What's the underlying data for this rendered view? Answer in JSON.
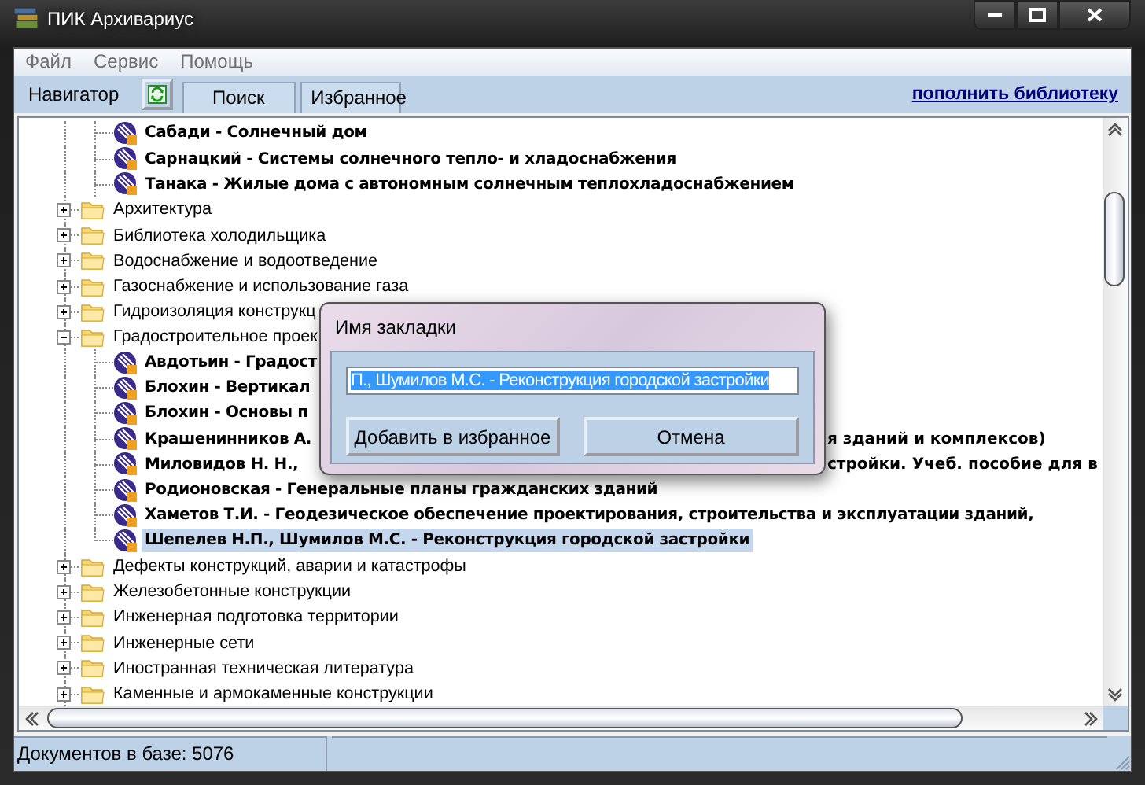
{
  "window": {
    "title": "ПИК Архивариус"
  },
  "menu": [
    "Файл",
    "Сервис",
    "Помощь"
  ],
  "tabs": [
    {
      "label": "Навигатор",
      "selected": true
    },
    {
      "label": "Поиск",
      "selected": false
    },
    {
      "label": "Избранное",
      "selected": false
    }
  ],
  "library_link": "пополнить библиотеку",
  "tree": {
    "items": [
      {
        "kind": "continuation",
        "children": [
          {
            "label": "Сабади - Солнечный дом",
            "selected": false
          },
          {
            "label": "Сарнацкий - Системы солнечного тепло- и хладоснабжения",
            "selected": false
          },
          {
            "label": "Танака - Жилые дома с автономным солнечным теплохладоснабжением",
            "selected": false
          }
        ]
      },
      {
        "kind": "folder",
        "label": "Архитектура",
        "expanded": false
      },
      {
        "kind": "folder",
        "label": "Библиотека холодильщика",
        "expanded": false
      },
      {
        "kind": "folder",
        "label": "Водоснабжение и водоотведение",
        "expanded": false
      },
      {
        "kind": "folder",
        "label": "Газоснабжение и использование газа",
        "expanded": false
      },
      {
        "kind": "folder",
        "label": "Гидроизоляция конструкц",
        "expanded": false
      },
      {
        "kind": "folder",
        "label": "Градостроительное проек",
        "expanded": true,
        "children": [
          {
            "label": "Авдотьин - Градост",
            "selected": false
          },
          {
            "label": "Блохин - Вертикал",
            "selected": false
          },
          {
            "label": "Блохин - Основы п",
            "selected": false
          },
          {
            "label": "Крашенинников А.",
            "tail": "я зданий и комплексов)",
            "selected": false
          },
          {
            "label": "Миловидов Н. Н.,",
            "tail": "стройки. Учеб. пособие для в",
            "selected": false
          },
          {
            "label": "Родионовская - Генеральные планы гражданских зданий",
            "selected": false
          },
          {
            "label": "Хаметов Т.И. - Геодезическое обеспечение проектирования, строительства и эксплуатации зданий,",
            "selected": false
          },
          {
            "label": "Шепелев Н.П., Шумилов М.С. - Реконструкция городской застройки",
            "selected": true
          }
        ]
      },
      {
        "kind": "folder",
        "label": "Дефекты конструкций, аварии и катастрофы",
        "expanded": false
      },
      {
        "kind": "folder",
        "label": "Железобетонные конструкции",
        "expanded": false
      },
      {
        "kind": "folder",
        "label": "Инженерная подготовка территории",
        "expanded": false
      },
      {
        "kind": "folder",
        "label": "Инженерные сети",
        "expanded": false
      },
      {
        "kind": "folder",
        "label": "Иностранная техническая литература",
        "expanded": false
      },
      {
        "kind": "folder",
        "label": "Каменные и армокаменные конструкции",
        "expanded": false
      }
    ]
  },
  "dialog": {
    "title": "Имя закладки",
    "value": "П., Шумилов М.С. - Реконструкция городской застройки",
    "buttons": [
      "Добавить в избранное",
      "Отмена"
    ]
  },
  "status_bar": {
    "text": "Документов в базе: 5076"
  }
}
